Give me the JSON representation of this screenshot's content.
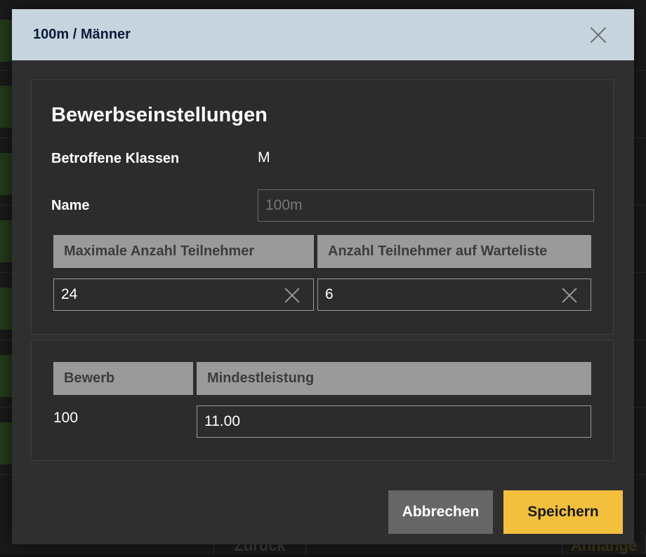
{
  "background": {
    "back_button_label": "Zurück",
    "next_button_label": "Anhänge"
  },
  "dialog": {
    "title": "100m / Männer",
    "close_icon": "close-icon"
  },
  "settings": {
    "section_title": "Bewerbseinstellungen",
    "affected_classes_label": "Betroffene Klassen",
    "affected_classes_value": "M",
    "name_label": "Name",
    "name_value": "100m",
    "max_participants_header": "Maximale Anzahl Teilnehmer",
    "waitlist_header": "Anzahl Teilnehmer auf Warteliste",
    "max_participants_value": "24",
    "waitlist_value": "6"
  },
  "table": {
    "headers": [
      "Bewerb",
      "Mindestleistung"
    ],
    "rows": [
      {
        "event": "100",
        "min_performance": "11.00"
      }
    ]
  },
  "footer": {
    "cancel_label": "Abbrechen",
    "save_label": "Speichern"
  },
  "colors": {
    "header_bg": "#c6d4dd",
    "save_button": "#f3c03d",
    "cancel_button": "#666666",
    "dialog_bg": "#2f2f2f"
  }
}
